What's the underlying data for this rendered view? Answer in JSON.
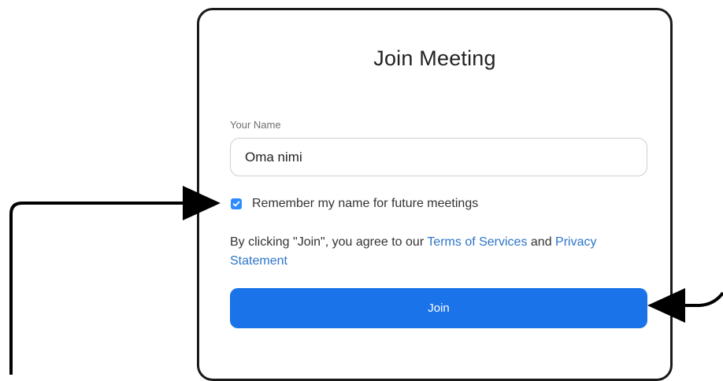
{
  "dialog": {
    "title": "Join Meeting",
    "name_label": "Your Name",
    "name_value": "Oma nimi",
    "remember_label": "Remember my name for future meetings",
    "remember_checked": true,
    "terms_prefix": "By clicking \"Join\", you agree to our ",
    "terms_link": "Terms of Services",
    "terms_and": " and ",
    "privacy_link": "Privacy Statement",
    "join_label": "Join"
  },
  "colors": {
    "accent": "#1a73e8",
    "link": "#2d74c9",
    "checkbox": "#2d8cff"
  }
}
